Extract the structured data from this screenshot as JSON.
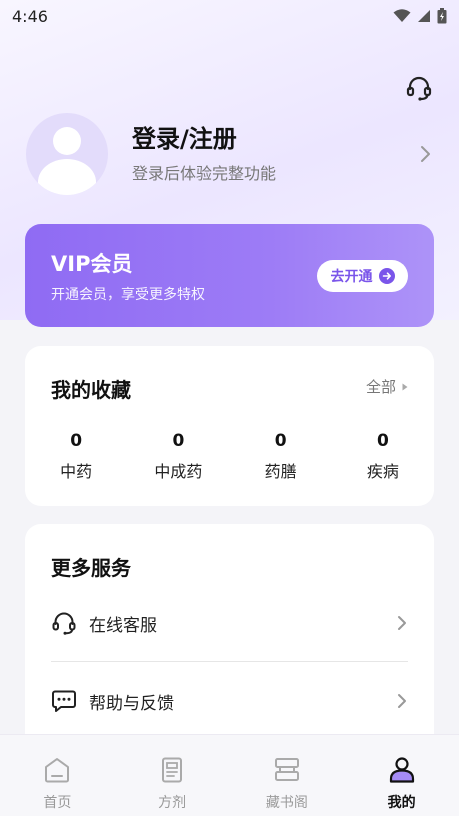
{
  "status_bar": {
    "time": "4:46",
    "icons": [
      "wifi-icon",
      "signal-icon",
      "battery-icon"
    ]
  },
  "header": {
    "support_icon": "headset-icon"
  },
  "profile": {
    "title": "登录/注册",
    "subtitle": "登录后体验完整功能"
  },
  "vip": {
    "title": "VIP会员",
    "subtitle": "开通会员，享受更多特权",
    "button_label": "去开通",
    "accent": "#8f6bf3"
  },
  "favorites": {
    "title": "我的收藏",
    "all_label": "全部",
    "stats": [
      {
        "value": "0",
        "label": "中药"
      },
      {
        "value": "0",
        "label": "中成药"
      },
      {
        "value": "0",
        "label": "药膳"
      },
      {
        "value": "0",
        "label": "疾病"
      }
    ]
  },
  "services": {
    "title": "更多服务",
    "items": [
      {
        "label": "在线客服",
        "icon": "headset-icon"
      },
      {
        "label": "帮助与反馈",
        "icon": "chat-icon"
      }
    ]
  },
  "bottom_nav": {
    "items": [
      {
        "label": "首页",
        "icon": "home-icon",
        "active": false
      },
      {
        "label": "方剂",
        "icon": "document-icon",
        "active": false
      },
      {
        "label": "藏书阁",
        "icon": "bookshelf-icon",
        "active": false
      },
      {
        "label": "我的",
        "icon": "profile-icon",
        "active": true
      }
    ]
  }
}
